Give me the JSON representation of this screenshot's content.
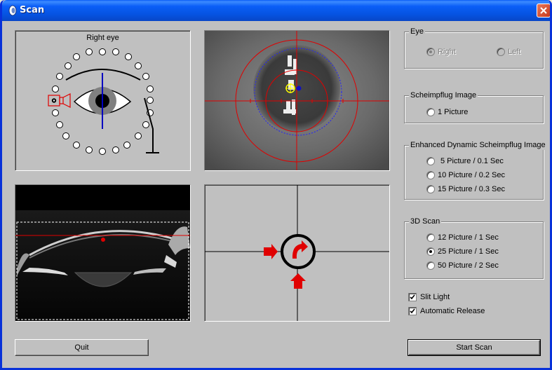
{
  "window": {
    "title": "Scan"
  },
  "eye_diagram": {
    "title": "Right eye"
  },
  "eye_group": {
    "title": "Eye",
    "options": [
      {
        "label": "Right",
        "selected": true,
        "enabled": false
      },
      {
        "label": "Left",
        "selected": false,
        "enabled": false
      }
    ]
  },
  "scheimpflug_group": {
    "title": "Scheimpflug Image",
    "options": [
      {
        "label": "1 Picture",
        "selected": false
      }
    ]
  },
  "enhanced_group": {
    "title": "Enhanced Dynamic Scheimpflug Image",
    "options": [
      {
        "label": "5 Picture / 0.1 Sec",
        "selected": false
      },
      {
        "label": "10 Picture / 0.2 Sec",
        "selected": false
      },
      {
        "label": "15 Picture / 0.3 Sec",
        "selected": false
      }
    ]
  },
  "scan3d_group": {
    "title": "3D Scan",
    "options": [
      {
        "label": "12 Picture / 1 Sec",
        "selected": false
      },
      {
        "label": "25 Picture / 1 Sec",
        "selected": true
      },
      {
        "label": "50 Picture / 2 Sec",
        "selected": false
      }
    ]
  },
  "checkboxes": [
    {
      "label": "Slit Light",
      "checked": true
    },
    {
      "label": "Automatic Release",
      "checked": true
    }
  ],
  "buttons": {
    "quit": "Quit",
    "start_scan": "Start Scan"
  },
  "colors": {
    "title_bar": "#0a5ef7",
    "crosshair": "#e00000",
    "direction_arrow": "#e00000",
    "dial_circle": "#000000"
  }
}
